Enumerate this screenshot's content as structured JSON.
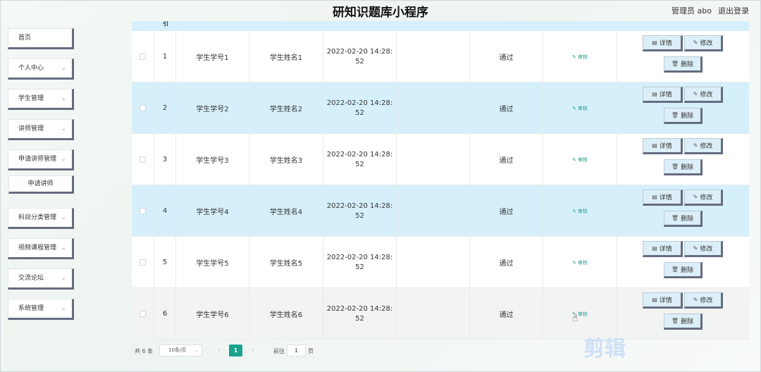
{
  "header": {
    "title": "研知识题库小程序",
    "admin": "管理员 abo",
    "logout": "退出登录"
  },
  "sidebar": {
    "items": [
      {
        "label": "首页",
        "has_chevron": false
      },
      {
        "label": "个人中心",
        "has_chevron": true
      },
      {
        "label": "学生管理",
        "has_chevron": true
      },
      {
        "label": "讲师管理",
        "has_chevron": true
      },
      {
        "label": "申请讲师管理",
        "has_chevron": true
      },
      {
        "label": "申请讲师",
        "sub": true
      },
      {
        "label": "科目分类管理",
        "has_chevron": true
      },
      {
        "label": "视频课程管理",
        "has_chevron": true
      },
      {
        "label": "交流论坛",
        "has_chevron": true
      },
      {
        "label": "系统管理",
        "has_chevron": true
      }
    ],
    "chevron": "⌄"
  },
  "table": {
    "header_fragment": "引",
    "rows": [
      {
        "index": "1",
        "student_no": "学生学号1",
        "student_name": "学生姓名1",
        "time_line1": "2022-02-20 14:28:",
        "time_line2": "52",
        "status": "通过",
        "audit": "审核"
      },
      {
        "index": "2",
        "student_no": "学生学号2",
        "student_name": "学生姓名2",
        "time_line1": "2022-02-20 14:28:",
        "time_line2": "52",
        "status": "通过",
        "audit": "审核"
      },
      {
        "index": "3",
        "student_no": "学生学号3",
        "student_name": "学生姓名3",
        "time_line1": "2022-02-20 14:28:",
        "time_line2": "52",
        "status": "通过",
        "audit": "审核"
      },
      {
        "index": "4",
        "student_no": "学生学号4",
        "student_name": "学生姓名4",
        "time_line1": "2022-02-20 14:28:",
        "time_line2": "52",
        "status": "通过",
        "audit": "审核"
      },
      {
        "index": "5",
        "student_no": "学生学号5",
        "student_name": "学生姓名5",
        "time_line1": "2022-02-20 14:28:",
        "time_line2": "52",
        "status": "通过",
        "audit": "审核"
      },
      {
        "index": "6",
        "student_no": "学生学号6",
        "student_name": "学生姓名6",
        "time_line1": "2022-02-20 14:28:",
        "time_line2": "52",
        "status": "通过",
        "audit": "审核"
      }
    ],
    "actions": {
      "detail": "详情",
      "edit": "修改",
      "delete": "删除"
    },
    "icons": {
      "detail": "▤",
      "edit": "✎",
      "delete": "🗑",
      "audit": "✎"
    }
  },
  "pagination": {
    "total": "共 6 条",
    "page_size": "10条/页",
    "prev": "‹",
    "next": "›",
    "current_page": "1",
    "goto_label": "前往",
    "goto_value": "1",
    "page_unit": "页"
  },
  "watermark": "剪辑",
  "colors": {
    "accent": "#1aa28c",
    "row_alt": "#d6f0fb",
    "button_shadow": "#656c80"
  }
}
